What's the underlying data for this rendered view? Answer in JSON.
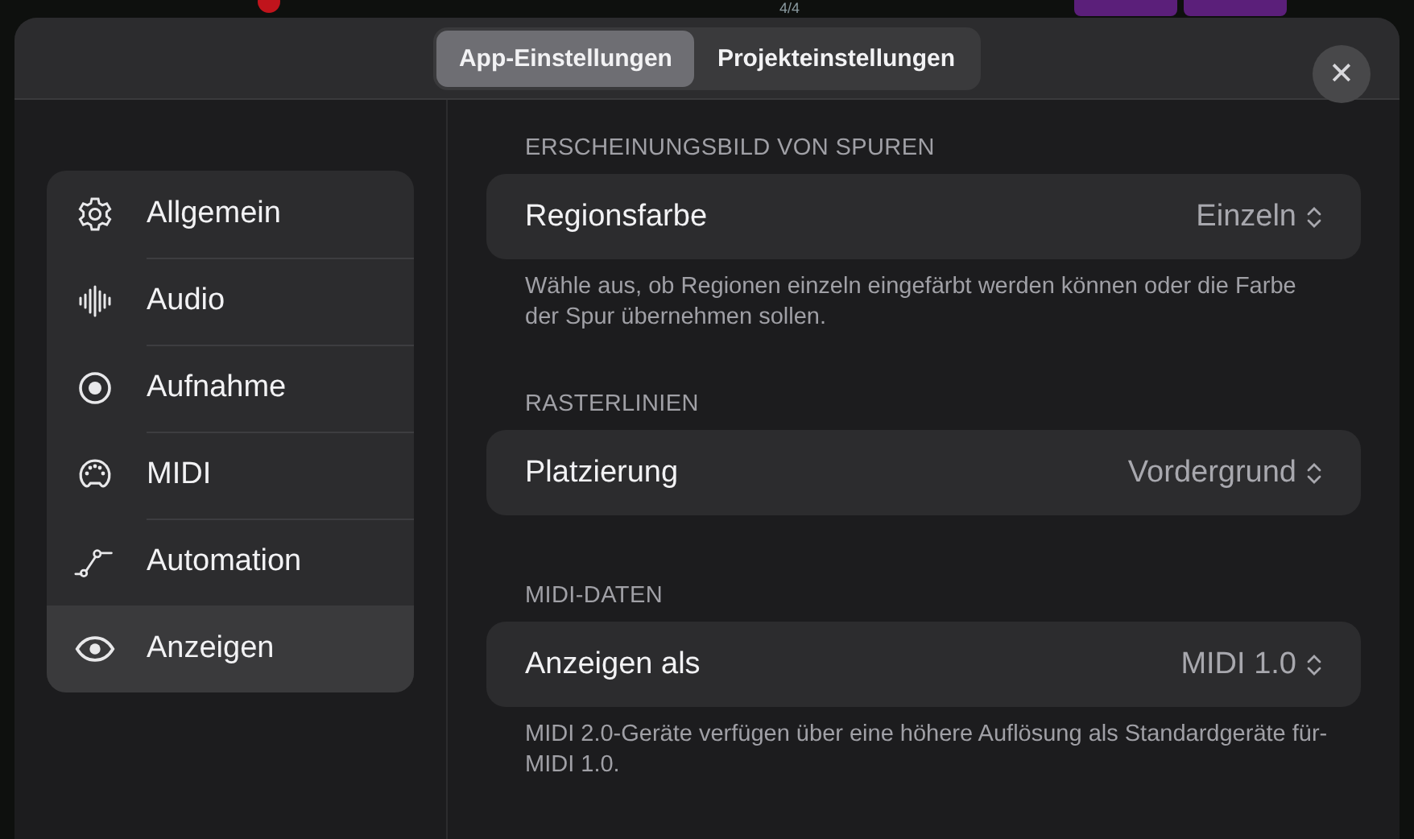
{
  "background_app": {
    "time_signature": "4/4"
  },
  "tabs": [
    {
      "label": "App-Einstellungen",
      "selected": true
    },
    {
      "label": "Projekteinstellungen",
      "selected": false
    }
  ],
  "close_button": {
    "label": "✕"
  },
  "sidebar": {
    "items": [
      {
        "label": "Allgemein",
        "kind": "gear",
        "selected": false
      },
      {
        "label": "Audio",
        "kind": "waveform",
        "selected": false
      },
      {
        "label": "Aufnahme",
        "kind": "record",
        "selected": false
      },
      {
        "label": "MIDI",
        "kind": "midi",
        "selected": false
      },
      {
        "label": "Automation",
        "kind": "automation",
        "selected": false
      },
      {
        "label": "Anzeigen",
        "kind": "eye",
        "selected": true
      }
    ]
  },
  "sections": [
    {
      "header": "ERSCHEINUNGSBILD VON SPUREN",
      "label": "Regionsfarbe",
      "value": "Einzeln",
      "description": "Wähle aus, ob Regionen einzeln eingefärbt werden können oder die Farbe der Spur übernehmen sollen."
    },
    {
      "header": "RASTERLINIEN",
      "label": "Platzierung",
      "value": "Vordergrund"
    },
    {
      "header": "MIDI-DATEN",
      "label": "Anzeigen als",
      "value": "MIDI 1.0",
      "description": "MIDI 2.0-Geräte verfügen über eine höhere Auflösung als Standardgeräte für-MIDI 1.0."
    }
  ]
}
